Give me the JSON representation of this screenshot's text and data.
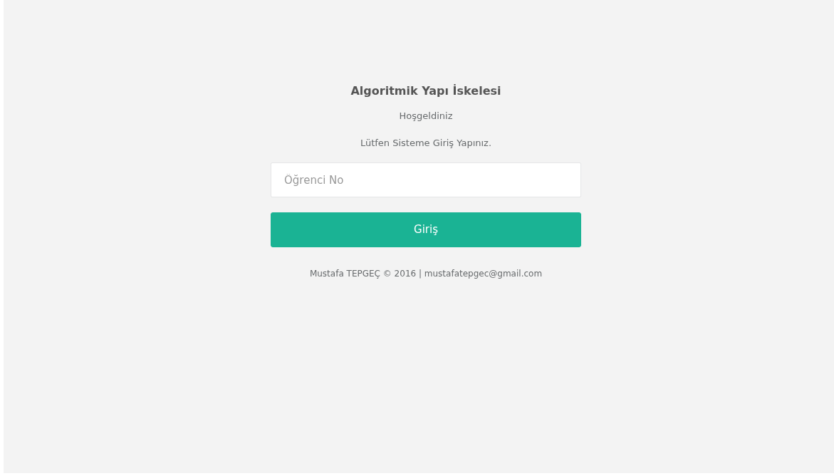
{
  "title": "Algoritmik Yapı İskelesi",
  "welcome": "Hoşgeldiniz",
  "instruction": "Lütfen Sisteme Giriş Yapınız.",
  "student_field": {
    "placeholder": "Öğrenci No"
  },
  "login_button": "Giriş",
  "footer": "Mustafa TEPGEÇ © 2016 | mustafatepgec@gmail.com"
}
